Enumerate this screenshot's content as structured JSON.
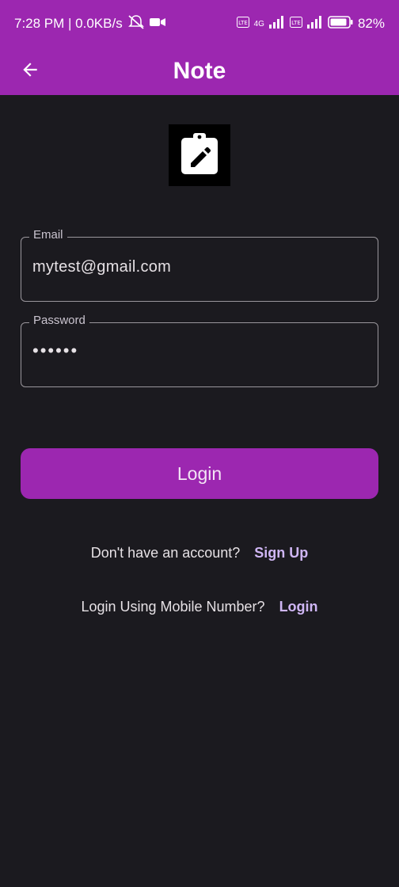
{
  "status_bar": {
    "time_speed": "7:28 PM | 0.0KB/s",
    "network_1": "4G",
    "battery": "82%"
  },
  "app_bar": {
    "title": "Note"
  },
  "form": {
    "email_label": "Email",
    "email_value": "mytest@gmail.com",
    "password_label": "Password",
    "password_value": "••••••",
    "login_button": "Login"
  },
  "signup_row": {
    "prompt": "Don't have an account?",
    "link": "Sign Up"
  },
  "mobile_row": {
    "prompt": "Login Using Mobile Number?",
    "link": "Login"
  },
  "colors": {
    "primary": "#9c27b0",
    "background": "#1b1a1f",
    "link": "#cfb6f4"
  }
}
